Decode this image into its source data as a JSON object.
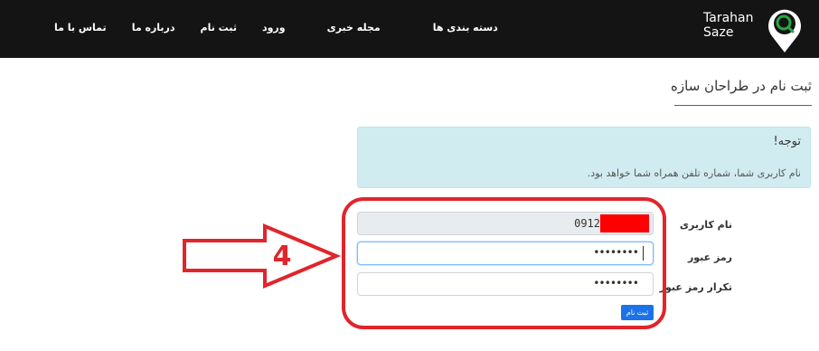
{
  "nav": {
    "links": [
      {
        "label": "دسته بندی ها"
      },
      {
        "label": "مجله خبری"
      },
      {
        "label": "ورود"
      },
      {
        "label": "ثبت نام"
      },
      {
        "label": "درباره ما"
      },
      {
        "label": "تماس با ما"
      }
    ],
    "logo": {
      "line1": "Tarahan",
      "line2": "Saze"
    }
  },
  "page": {
    "title": "ثبت نام در طراحان سازه"
  },
  "alert": {
    "title": "توجه!",
    "text": "نام کاربری شما، شماره تلفن همراه شما خواهد بود."
  },
  "form": {
    "username": {
      "label": "نام کاربری",
      "value": "0912"
    },
    "password": {
      "label": "رمز عبور",
      "value": "••••••••"
    },
    "confirm": {
      "label": "تکرار رمز عبور",
      "value": "••••••••"
    },
    "submit_label": "ثبت نام"
  },
  "annotation": {
    "step_number": "4"
  },
  "colors": {
    "navbar": "#141414",
    "alert_bg": "#d1ecf1",
    "annotation_red": "#e0252b",
    "button": "#1a73e8",
    "title_rule": "#2e7d32"
  }
}
